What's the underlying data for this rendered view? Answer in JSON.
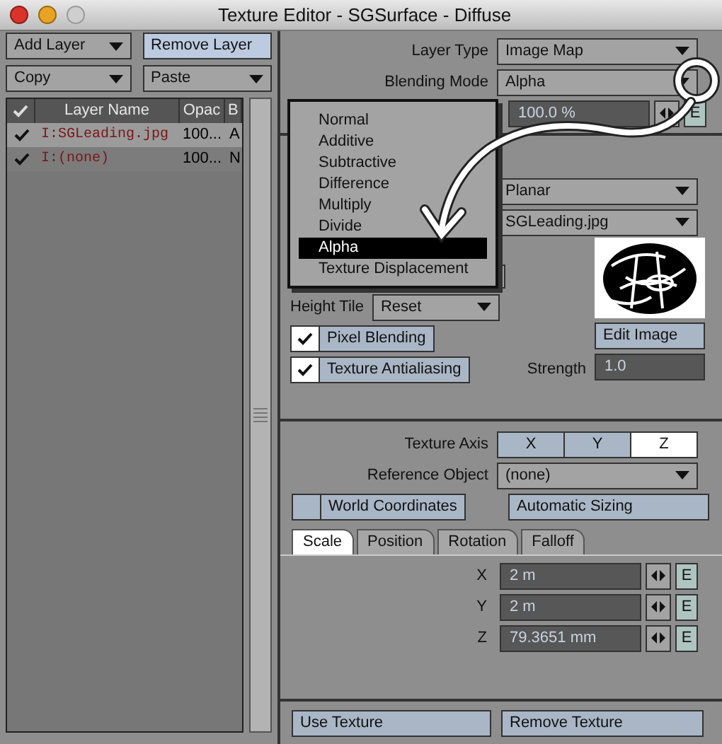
{
  "window": {
    "title": "Texture Editor - SGSurface - Diffuse"
  },
  "layers_panel": {
    "add_layer": "Add Layer",
    "remove_layer": "Remove Layer",
    "copy": "Copy",
    "paste": "Paste",
    "columns": [
      "Layer Name",
      "Opac",
      "B"
    ],
    "rows": [
      {
        "checked": true,
        "selected": true,
        "name": "I:SGLeading.jpg",
        "opacity": "100...",
        "blend": "A"
      },
      {
        "checked": true,
        "selected": false,
        "name": "I:(none)",
        "opacity": "100...",
        "blend": "N"
      }
    ]
  },
  "layer_settings": {
    "layer_type": {
      "label": "Layer Type",
      "value": "Image Map"
    },
    "blending_mode": {
      "label": "Blending Mode",
      "value": "Alpha"
    },
    "opacity": {
      "value": "100.0 %",
      "envelope": "E"
    }
  },
  "image_settings": {
    "projection": "Planar",
    "image": "SGLeading.jpg",
    "height_tile": {
      "label": "Height Tile",
      "value": "Reset"
    },
    "pixel_blending": {
      "label": "Pixel Blending",
      "checked": true
    },
    "texture_antialiasing": {
      "label": "Texture Antialiasing",
      "checked": true
    },
    "edit_image": "Edit Image",
    "strength": {
      "label": "Strength",
      "value": "1.0"
    }
  },
  "axis_settings": {
    "texture_axis": {
      "label": "Texture Axis",
      "options": [
        {
          "label": "X",
          "selected": false
        },
        {
          "label": "Y",
          "selected": false
        },
        {
          "label": "Z",
          "selected": true
        }
      ]
    },
    "reference_object": {
      "label": "Reference Object",
      "value": "(none)"
    },
    "world_coordinates": {
      "label": "World Coordinates",
      "checked": false
    },
    "automatic_sizing": "Automatic Sizing",
    "tabs": [
      {
        "label": "Scale",
        "selected": true
      },
      {
        "label": "Position",
        "selected": false
      },
      {
        "label": "Rotation",
        "selected": false
      },
      {
        "label": "Falloff",
        "selected": false
      }
    ],
    "fields": [
      {
        "axis": "X",
        "value": "2 m",
        "envelope": "E"
      },
      {
        "axis": "Y",
        "value": "2 m",
        "envelope": "E"
      },
      {
        "axis": "Z",
        "value": "79.3651 mm",
        "envelope": "E"
      }
    ]
  },
  "buttons": [
    "Use Texture",
    "Remove Texture"
  ],
  "blending_menu": {
    "items": [
      {
        "label": "Normal",
        "selected": false
      },
      {
        "label": "Additive",
        "selected": false
      },
      {
        "label": "Subtractive",
        "selected": false
      },
      {
        "label": "Difference",
        "selected": false
      },
      {
        "label": "Multiply",
        "selected": false
      },
      {
        "label": "Divide",
        "selected": false
      },
      {
        "label": "Alpha",
        "selected": true
      },
      {
        "label": "Texture Displacement",
        "selected": false
      }
    ]
  }
}
